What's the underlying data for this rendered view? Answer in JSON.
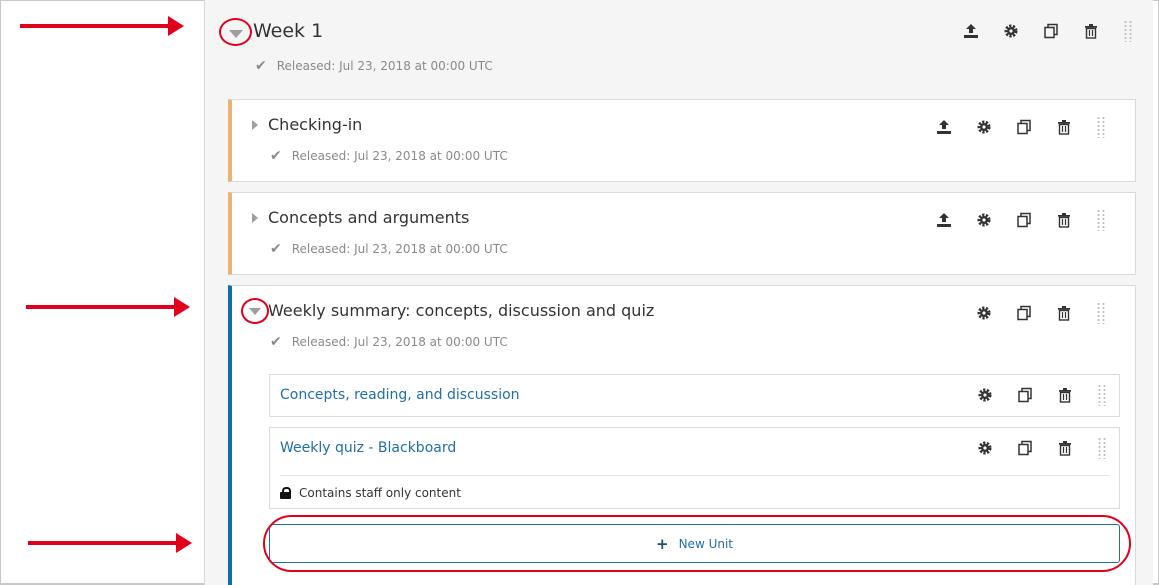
{
  "section": {
    "title": "Week 1",
    "release": "Released: Jul 23, 2018 at 00:00 UTC"
  },
  "subsections": [
    {
      "title": "Checking-in",
      "release": "Released: Jul 23, 2018 at 00:00 UTC"
    },
    {
      "title": "Concepts and arguments",
      "release": "Released: Jul 23, 2018 at 00:00 UTC"
    },
    {
      "title": "Weekly summary: concepts, discussion and quiz",
      "release": "Released: Jul 23, 2018 at 00:00 UTC",
      "units": [
        {
          "title": "Concepts, reading, and discussion"
        },
        {
          "title": "Weekly quiz - Blackboard",
          "note": "Contains staff only content"
        }
      ],
      "new_unit_label": "New Unit"
    }
  ],
  "icons": {
    "publish": "publish-icon",
    "settings": "gear-icon",
    "duplicate": "duplicate-icon",
    "delete": "trash-icon",
    "drag": "drag-handle-icon",
    "check": "check-icon",
    "lock": "lock-icon",
    "expand": "chevron-down-icon",
    "collapsed": "chevron-right-icon"
  },
  "colors": {
    "annotation": "#e0001b",
    "subsection_accent": "#f0b273",
    "open_accent": "#0a6fae",
    "link": "#1f6fa8"
  }
}
